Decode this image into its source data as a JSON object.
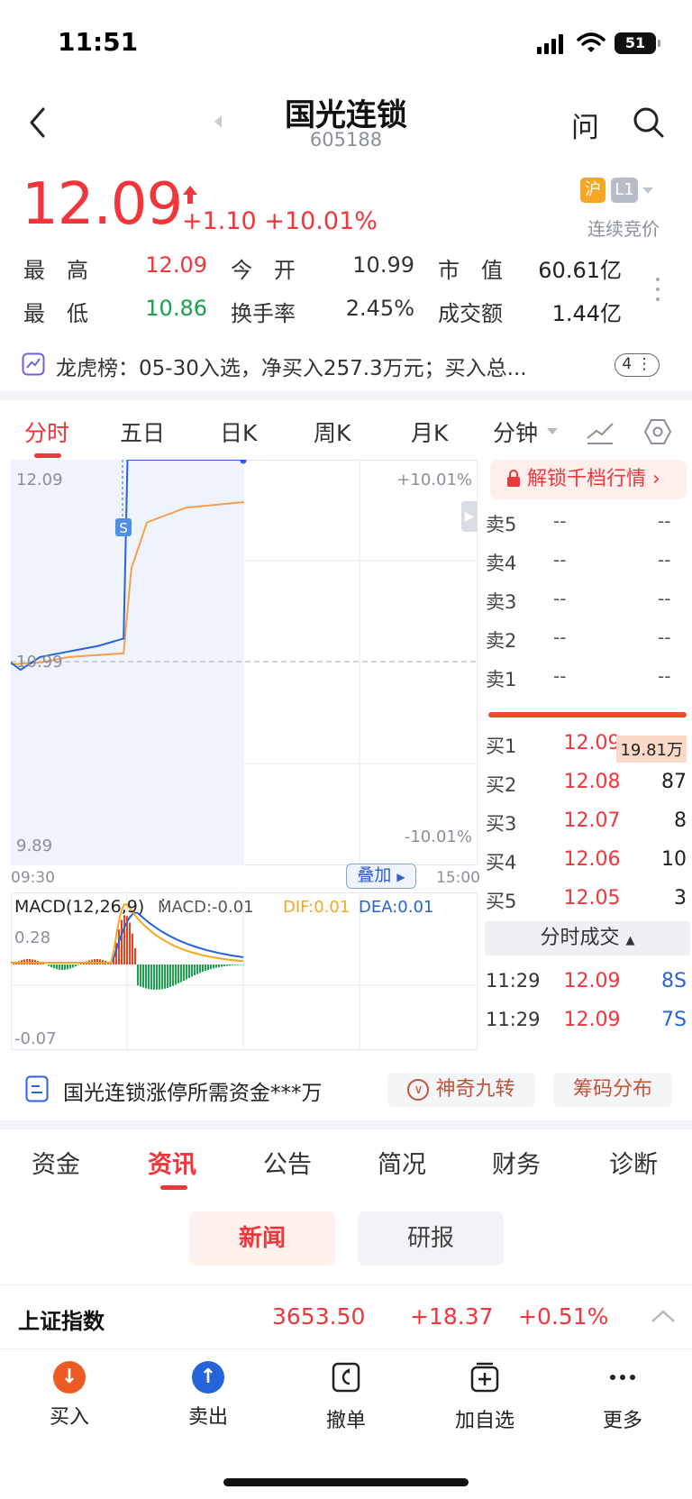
{
  "status_bar": {
    "time": "11:51",
    "battery": "51"
  },
  "header": {
    "name": "国光连锁",
    "code": "605188",
    "ask_icon": "问"
  },
  "quote": {
    "price": "12.09",
    "change": "+1.10 +10.01%",
    "tag_exchange": "沪",
    "tag_level": "L1",
    "trading_state": "连续竞价",
    "high_label": "最　高",
    "high": "12.09",
    "open_label": "今　开",
    "open": "10.99",
    "cap_label": "市　值",
    "cap": "60.61亿",
    "low_label": "最　低",
    "low": "10.86",
    "turnover_label": "换手率",
    "turnover": "2.45%",
    "amount_label": "成交额",
    "amount": "1.44亿"
  },
  "lhb": {
    "text": "龙虎榜：05-30入选，净买入257.3万元；买入总...",
    "count": "4"
  },
  "chart_tabs": [
    "分时",
    "五日",
    "日K",
    "周K",
    "月K",
    "分钟"
  ],
  "intraday": {
    "price_high": "12.09",
    "price_mid": "10.99",
    "price_low": "9.89",
    "pct_high": "+10.01%",
    "pct_low": "-10.01%",
    "time_start": "09:30",
    "time_end": "15:00",
    "overlay_label": "叠加",
    "marker": "S",
    "macd_title": "MACD(12,26,9)",
    "macd": "MACD:-0.01",
    "dif": "DIF:0.01",
    "dea": "DEA:0.01",
    "macd_high": "0.28",
    "macd_low": "-0.07"
  },
  "chart_data": {
    "type": "line",
    "x_range": [
      "09:30",
      "15:00"
    ],
    "y_range": [
      9.89,
      12.09
    ],
    "reference_price": 10.99,
    "series": [
      {
        "x": [
          "09:30",
          "09:35",
          "09:45",
          "10:00",
          "10:15",
          "10:28",
          "10:30",
          "10:45",
          "11:00",
          "11:15",
          "11:30"
        ],
        "values": [
          10.99,
          10.95,
          11.02,
          11.05,
          11.08,
          11.12,
          12.09,
          12.09,
          12.09,
          12.09,
          12.09
        ]
      },
      {
        "x": [
          "09:30",
          "09:45",
          "10:00",
          "10:28",
          "10:32",
          "10:40",
          "11:00",
          "11:30"
        ],
        "values": [
          10.98,
          10.99,
          11.02,
          11.04,
          11.5,
          11.75,
          11.83,
          11.86
        ]
      }
    ]
  },
  "unlock": "解锁千档行情",
  "order_book": {
    "sells": [
      {
        "label": "卖5",
        "price": "--",
        "vol": "--"
      },
      {
        "label": "卖4",
        "price": "--",
        "vol": "--"
      },
      {
        "label": "卖3",
        "price": "--",
        "vol": "--"
      },
      {
        "label": "卖2",
        "price": "--",
        "vol": "--"
      },
      {
        "label": "卖1",
        "price": "--",
        "vol": "--"
      }
    ],
    "buys": [
      {
        "label": "买1",
        "price": "12.09",
        "vol": "19.81万"
      },
      {
        "label": "买2",
        "price": "12.08",
        "vol": "87"
      },
      {
        "label": "买3",
        "price": "12.07",
        "vol": "8"
      },
      {
        "label": "买4",
        "price": "12.06",
        "vol": "10"
      },
      {
        "label": "买5",
        "price": "12.05",
        "vol": "3"
      }
    ],
    "ticks_header": "分时成交",
    "ticks": [
      {
        "time": "11:29",
        "price": "12.09",
        "vol": "8S"
      },
      {
        "time": "11:29",
        "price": "12.09",
        "vol": "7S"
      }
    ]
  },
  "promo": {
    "text": "国光连锁涨停所需资金***万",
    "btn1": "神奇九转",
    "btn2": "筹码分布"
  },
  "bottom_tabs": [
    "资金",
    "资讯",
    "公告",
    "简况",
    "财务",
    "诊断"
  ],
  "sub_tabs": [
    "新闻",
    "研报"
  ],
  "index_row": {
    "name": "上证指数",
    "value": "3653.50",
    "change": "+18.37",
    "pct": "+0.51%"
  },
  "nav": [
    "买入",
    "卖出",
    "撤单",
    "加自选",
    "更多"
  ]
}
